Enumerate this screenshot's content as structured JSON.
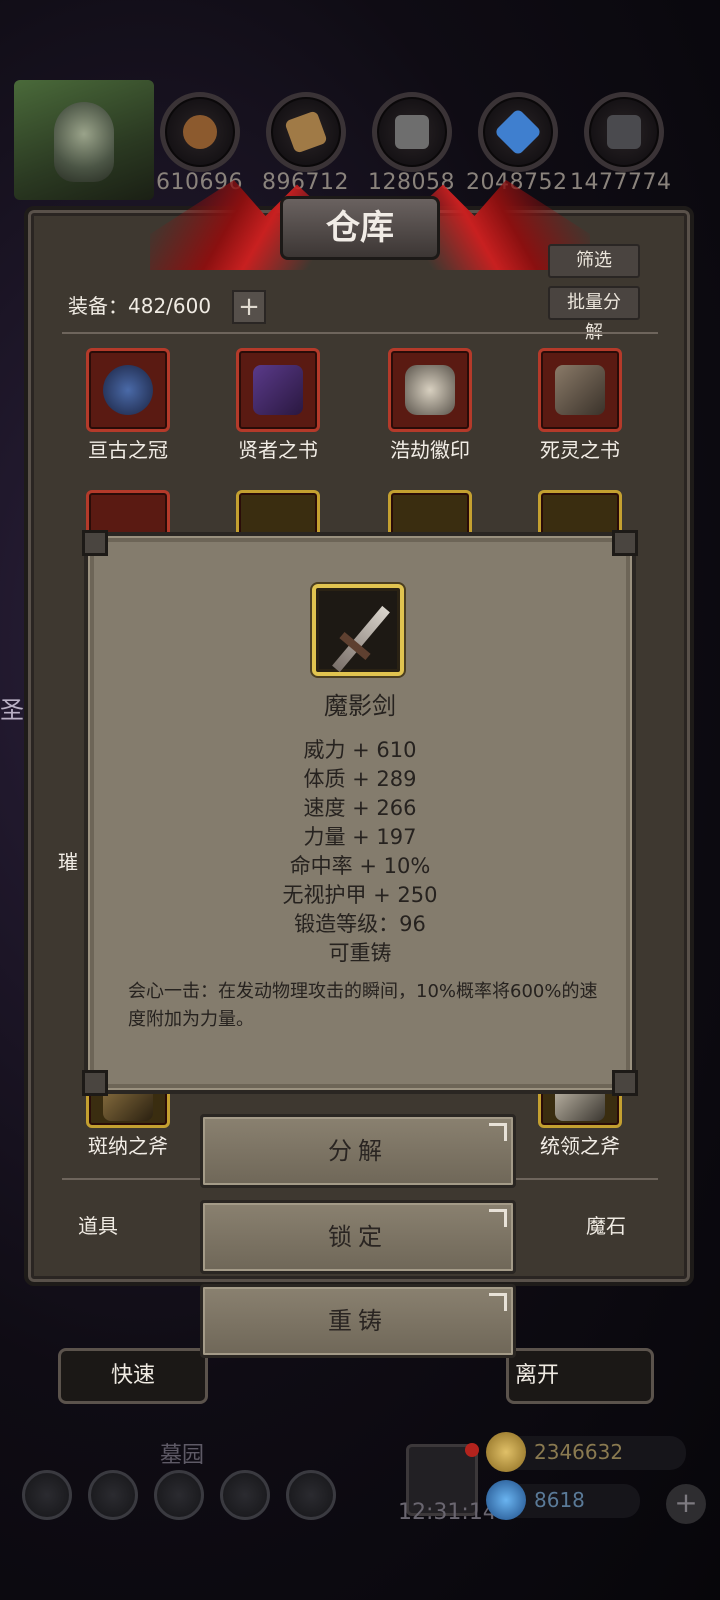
{
  "background": {
    "side_text": "圣"
  },
  "resources": [
    {
      "icon": "wood-icon",
      "value": "610696",
      "color": "#8c5a2e"
    },
    {
      "icon": "plank-icon",
      "value": "896712",
      "color": "#a07a46"
    },
    {
      "icon": "stone-icon",
      "value": "128058",
      "color": "#6e6e6e"
    },
    {
      "icon": "crystal-icon",
      "value": "2048752",
      "color": "#3f7fcf"
    },
    {
      "icon": "iron-icon",
      "value": "1477774",
      "color": "#4a4a4e"
    }
  ],
  "warehouse": {
    "title": "仓库",
    "filter_label": "筛选",
    "bulk_label": "批量分解",
    "equip_count": "装备：482/600",
    "items_row1": [
      {
        "label": "亘古之冠",
        "icon": "crown-icon",
        "frame": "red"
      },
      {
        "label": "贤者之书",
        "icon": "tome-icon",
        "frame": "red"
      },
      {
        "label": "浩劫徽印",
        "icon": "seal-icon",
        "frame": "red"
      },
      {
        "label": "死灵之书",
        "icon": "necro-book-icon",
        "frame": "red"
      }
    ],
    "items_row2_left_label": "璀",
    "items_bottom": [
      {
        "label": "斑纳之斧",
        "icon": "axe-icon"
      },
      {
        "label": "统领之斧",
        "icon": "axe-icon"
      }
    ],
    "tabs": {
      "items": "道具",
      "magic_stone": "魔石"
    },
    "bottom_buttons": {
      "quick": "快速",
      "leave": "离开"
    }
  },
  "hud": {
    "location": "墓园",
    "clock": "12:31:14",
    "gold": "2346632",
    "gems": "8618",
    "gold_color": "#c8a24a",
    "gem_color": "#3a8ad0"
  },
  "tooltip": {
    "name": "魔影剑",
    "stats": [
      "威力 + 610",
      "体质 + 289",
      "速度 + 266",
      "力量 + 197",
      "命中率 + 10%",
      "无视护甲 + 250",
      "锻造等级：96",
      "可重铸"
    ],
    "description": "会心一击：在发动物理攻击的瞬间，10%概率将600%的速度附加为力量。"
  },
  "actions": {
    "decompose": "分解",
    "lock": "锁定",
    "reforge": "重铸"
  }
}
